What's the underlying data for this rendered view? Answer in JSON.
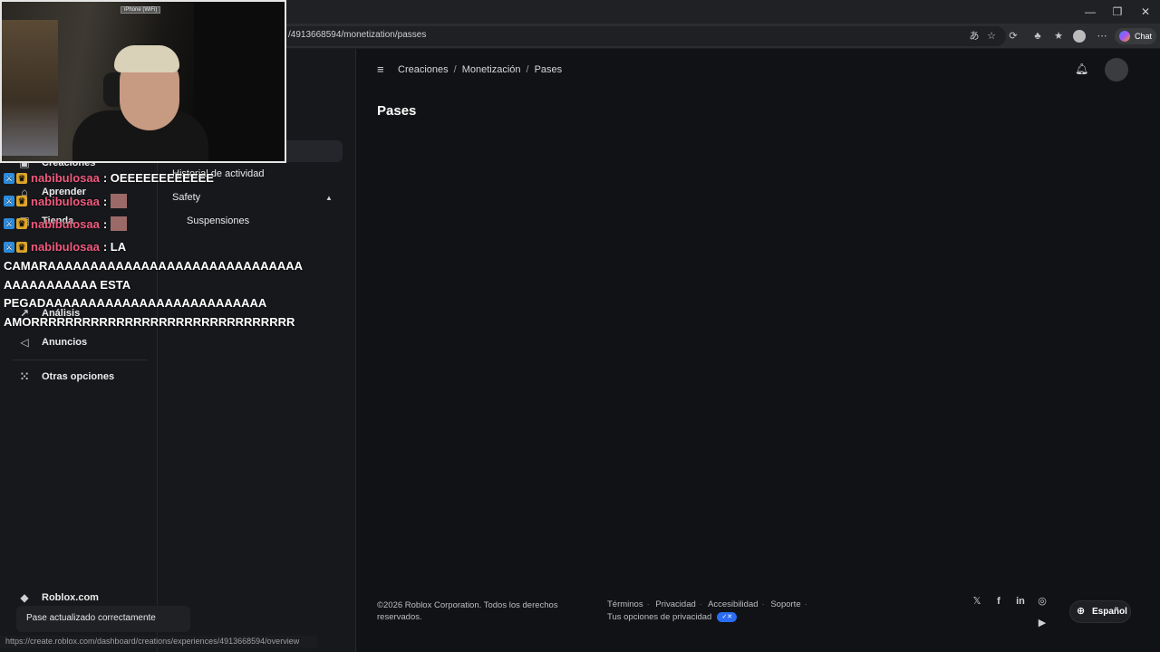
{
  "browser": {
    "url": "/4913668594/monetization/passes",
    "chat_label": "Chat",
    "status_url": "https://create.roblox.com/dashboard/creations/experiences/4913668594/overview"
  },
  "nav": {
    "items": [
      {
        "label": "Creaciones",
        "icon": "cube-icon"
      },
      {
        "label": "Aprender",
        "icon": "graduation-icon"
      },
      {
        "label": "Tienda",
        "icon": "store-icon"
      },
      {
        "label": "Análisis",
        "icon": "chart-icon"
      },
      {
        "label": "Anuncios",
        "icon": "megaphone-icon"
      },
      {
        "label": "Otras opciones",
        "icon": "grid-icon"
      }
    ],
    "roblox_link": "Roblox.com"
  },
  "subnav": {
    "activity": "Historial de actividad",
    "safety": "Safety",
    "suspensions": "Suspensiones"
  },
  "header": {
    "breadcrumb": [
      "Creaciones",
      "Monetización",
      "Pases"
    ],
    "page_title": "Pases"
  },
  "footer": {
    "copyright": "©2026 Roblox Corporation. Todos los derechos reservados.",
    "links": [
      "Términos",
      "Privacidad",
      "Accesibilidad",
      "Soporte"
    ],
    "privacy_choices": "Tus opciones de privacidad",
    "language": "Español"
  },
  "toast": "Pase actualizado correctamente",
  "webcam": {
    "label": "iPhone (WiFi)"
  },
  "chat_overlay": {
    "messages": [
      {
        "user": "nabibulosaa",
        "text": ": OEEEEEEEEEEEE"
      },
      {
        "user": "nabibulosaa",
        "text": ":"
      },
      {
        "user": "nabibulosaa",
        "text": ":"
      },
      {
        "user": "nabibulosaa",
        "text": ": LA"
      }
    ],
    "wrapped_lines": [
      "CAMARAAAAAAAAAAAAAAAAAAAAAAAAAAAAAA",
      "AAAAAAAAAAA ESTA",
      "PEGADAAAAAAAAAAAAAAAAAAAAAAAAAA",
      "AMORRRRRRRRRRRRRRRRRRRRRRRRRRRRRRR"
    ]
  }
}
